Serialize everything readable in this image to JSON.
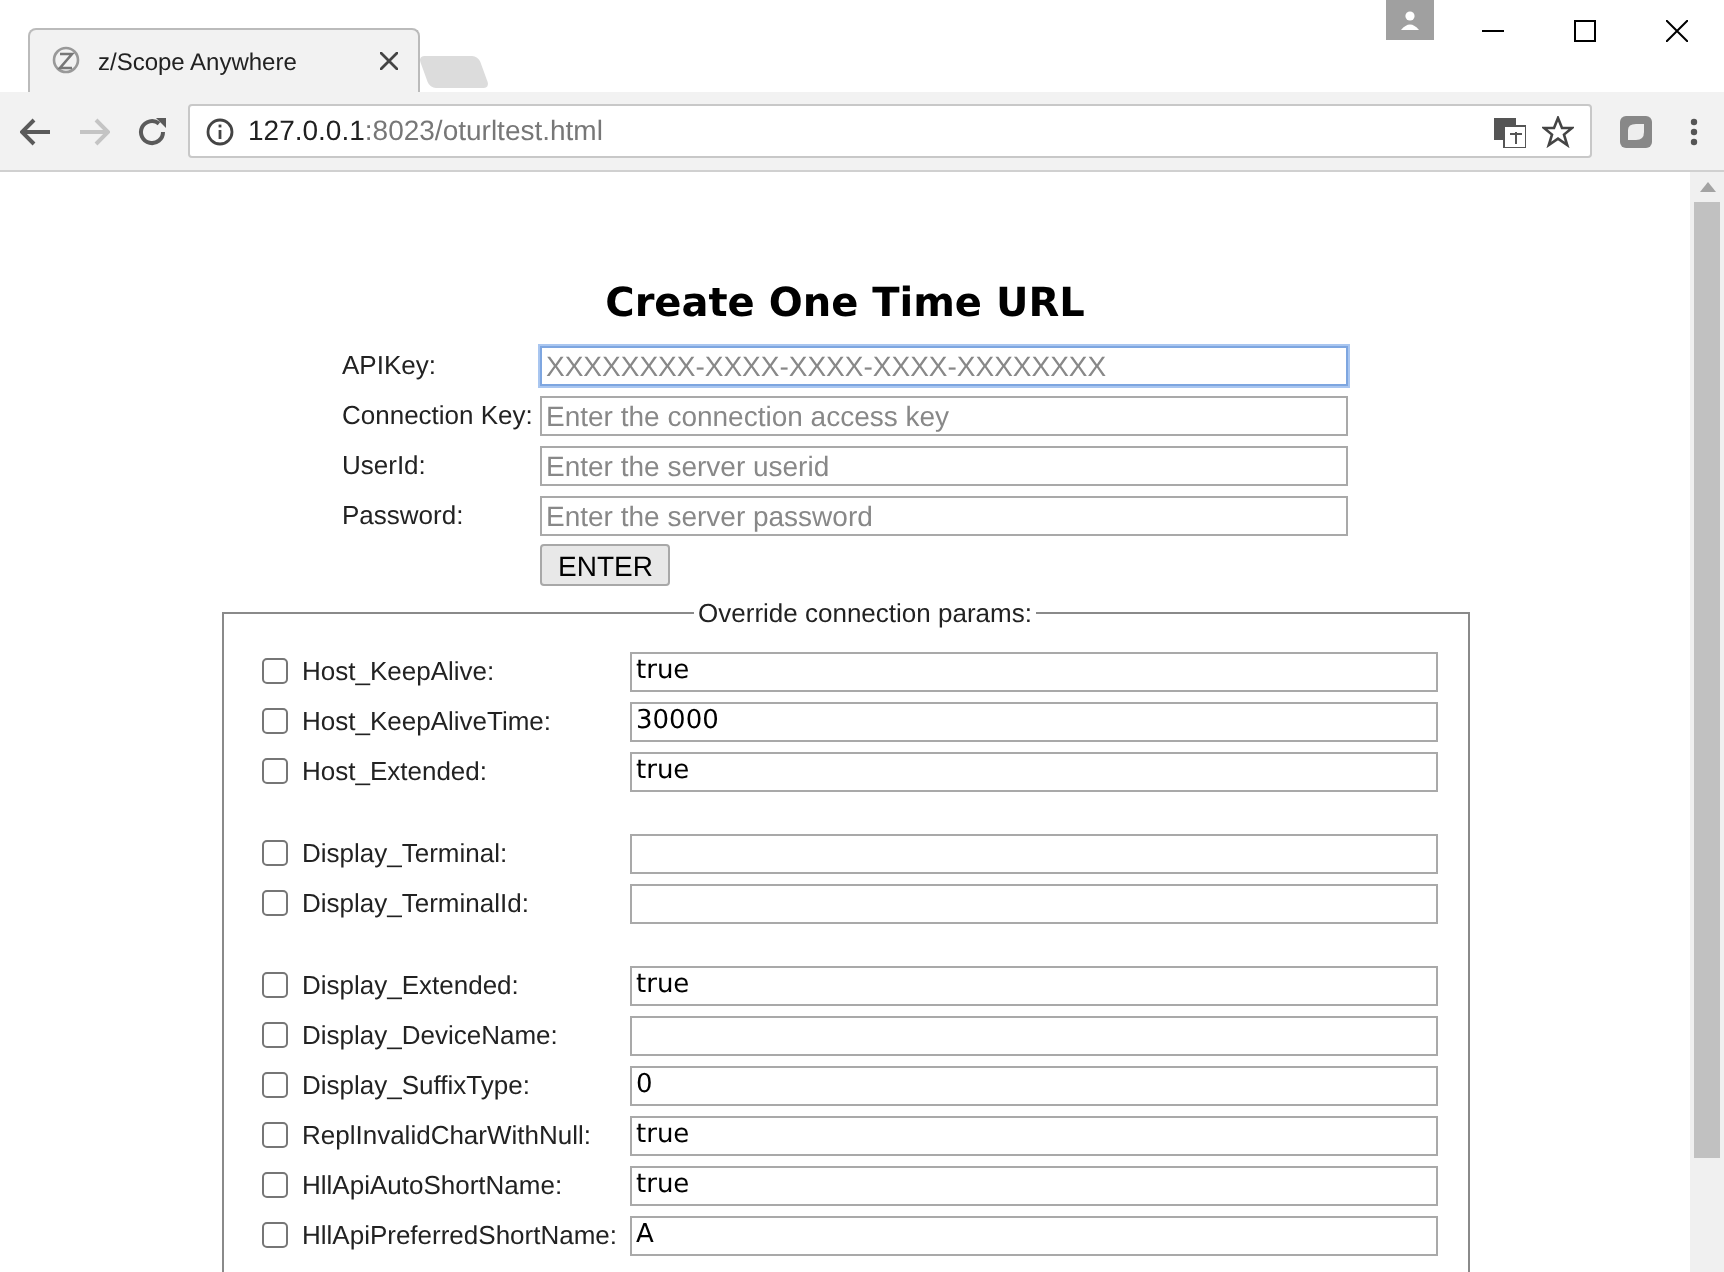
{
  "browser": {
    "tabs": [
      {
        "title": "z/Scope Anywhere",
        "selected": true
      }
    ],
    "address": {
      "host": "127.0.0.1",
      "rest": ":8023/oturltest.html"
    }
  },
  "page": {
    "title": "Create One Time URL",
    "fields": [
      {
        "label": "APIKey:",
        "placeholder": "XXXXXXXX-XXXX-XXXX-XXXX-XXXXXXXX",
        "focused": true
      },
      {
        "label": "Connection Key:",
        "placeholder": "Enter the connection access key",
        "focused": false
      },
      {
        "label": "UserId:",
        "placeholder": "Enter the server userid",
        "focused": false
      },
      {
        "label": "Password:",
        "placeholder": "Enter the server password",
        "focused": false
      }
    ],
    "submit": "ENTER",
    "override": {
      "legend": "Override connection params:",
      "groups": [
        [
          {
            "label": "Host_KeepAlive:",
            "checked": false,
            "value": "true"
          },
          {
            "label": "Host_KeepAliveTime:",
            "checked": false,
            "value": "30000"
          },
          {
            "label": "Host_Extended:",
            "checked": false,
            "value": "true"
          }
        ],
        [
          {
            "label": "Display_Terminal:",
            "checked": false
          },
          {
            "label": "Display_TerminalId:",
            "checked": false
          }
        ],
        [
          {
            "label": "Display_Extended:",
            "checked": false,
            "value": "true"
          },
          {
            "label": "Display_DeviceName:",
            "checked": false
          },
          {
            "label": "Display_SuffixType:",
            "checked": false,
            "value": "0"
          },
          {
            "label": "ReplInvalidCharWithNull:",
            "checked": false,
            "value": "true"
          },
          {
            "label": "HllApiAutoShortName:",
            "checked": false,
            "value": "true"
          },
          {
            "label": "HllApiPreferredShortName:",
            "checked": false,
            "value": "A"
          }
        ]
      ]
    }
  }
}
